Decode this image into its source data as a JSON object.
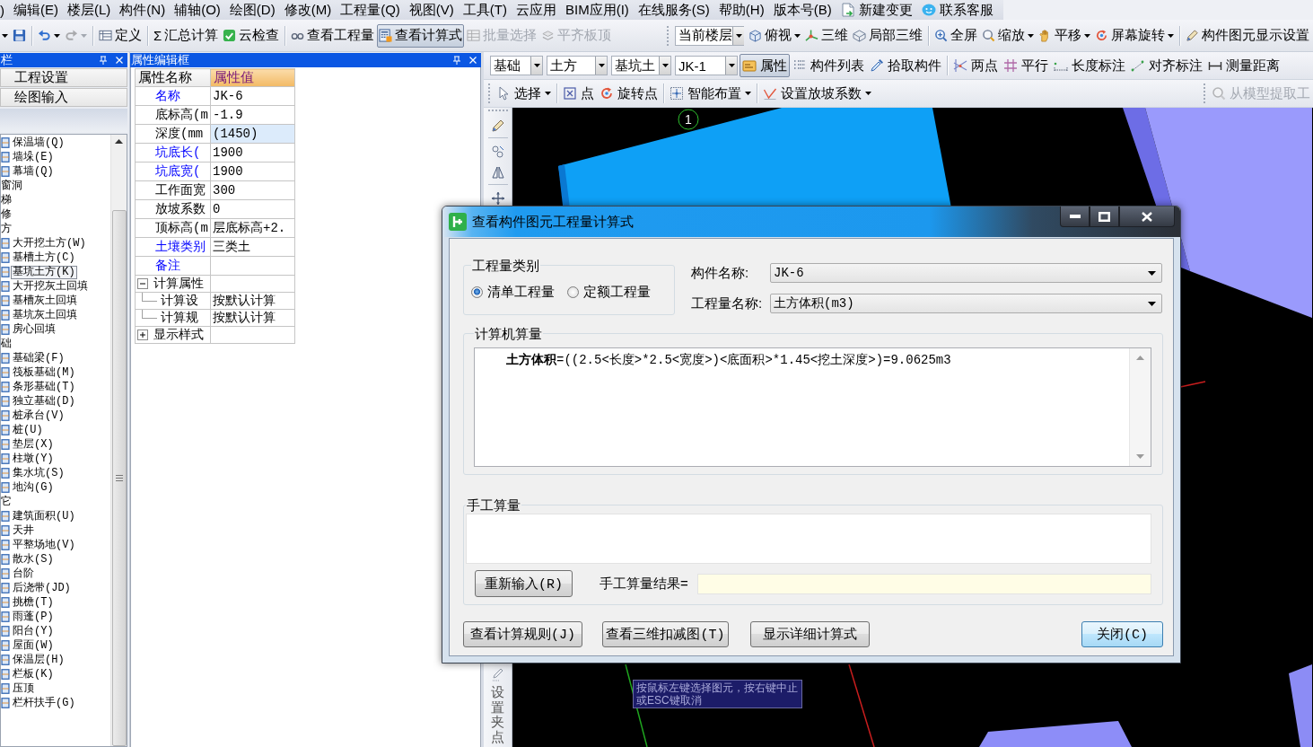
{
  "menu_bar": {
    "items": [
      {
        "kind": "plain",
        "label": ")"
      },
      {
        "kind": "plain",
        "label": "编辑(E)"
      },
      {
        "kind": "plain",
        "label": "楼层(L)"
      },
      {
        "kind": "plain",
        "label": "构件(N)"
      },
      {
        "kind": "plain",
        "label": "辅轴(O)"
      },
      {
        "kind": "plain",
        "label": "绘图(D)"
      },
      {
        "kind": "plain",
        "label": "修改(M)"
      },
      {
        "kind": "plain",
        "label": "工程量(Q)"
      },
      {
        "kind": "plain",
        "label": "视图(V)"
      },
      {
        "kind": "plain",
        "label": "工具(T)"
      },
      {
        "kind": "plain",
        "label": "云应用"
      },
      {
        "kind": "plain",
        "label": "BIM应用(I)"
      },
      {
        "kind": "plain",
        "label": "在线服务(S)"
      },
      {
        "kind": "plain",
        "label": "帮助(H)"
      },
      {
        "kind": "plain",
        "label": "版本号(B)"
      },
      {
        "kind": "document",
        "label": "新建变更"
      },
      {
        "kind": "chat",
        "label": "联系客服"
      }
    ]
  },
  "file_toolbar": {
    "items": [
      {
        "kind": "caret"
      },
      {
        "kind": "button",
        "dropdown": false,
        "pressed": false,
        "disabled": false
      },
      {
        "kind": "separator"
      },
      {
        "kind": "button",
        "dropdown": true,
        "pressed": false,
        "disabled": false
      },
      {
        "kind": "button",
        "dropdown": true,
        "pressed": false,
        "disabled": true
      },
      {
        "kind": "separator"
      },
      {
        "kind": "button",
        "label": "定义",
        "dropdown": false,
        "pressed": false,
        "disabled": false
      },
      {
        "kind": "separator"
      },
      {
        "kind": "button",
        "symbol": "Σ",
        "label": "汇总计算",
        "dropdown": false,
        "pressed": false,
        "disabled": false
      },
      {
        "kind": "button",
        "label": "云检查",
        "dropdown": false,
        "pressed": false,
        "disabled": false
      },
      {
        "kind": "separator"
      },
      {
        "kind": "button",
        "label": "查看工程量",
        "dropdown": false,
        "pressed": false,
        "disabled": false
      },
      {
        "kind": "button",
        "label": "查看计算式",
        "dropdown": false,
        "pressed": true,
        "disabled": false
      },
      {
        "kind": "button",
        "label": "批量选择",
        "dropdown": false,
        "pressed": false,
        "disabled": true
      },
      {
        "kind": "button",
        "label": "平齐板顶",
        "dropdown": false,
        "pressed": false,
        "disabled": true
      }
    ]
  },
  "view_toolbar": {
    "items": [
      {
        "kind": "combo",
        "value": "当前楼层"
      },
      {
        "kind": "button",
        "label": "俯视",
        "dropdown": true,
        "pressed": false,
        "disabled": false
      },
      {
        "kind": "button",
        "label": "三维",
        "dropdown": false,
        "pressed": false,
        "disabled": false
      },
      {
        "kind": "button",
        "label": "局部三维",
        "dropdown": false,
        "pressed": false,
        "disabled": false
      },
      {
        "kind": "separator"
      },
      {
        "kind": "button",
        "label": "全屏",
        "dropdown": false,
        "pressed": false,
        "disabled": false
      },
      {
        "kind": "button",
        "label": "缩放",
        "dropdown": true,
        "pressed": false,
        "disabled": false
      },
      {
        "kind": "button",
        "label": "平移",
        "dropdown": true,
        "pressed": false,
        "disabled": false
      },
      {
        "kind": "button",
        "label": "屏幕旋转",
        "dropdown": true,
        "pressed": false,
        "disabled": false
      },
      {
        "kind": "separator"
      },
      {
        "kind": "button",
        "label": "构件图元显示设置",
        "dropdown": false,
        "pressed": false,
        "disabled": false
      }
    ]
  },
  "component_toolbar": {
    "items": [
      {
        "kind": "combo",
        "value": "基础"
      },
      {
        "kind": "combo",
        "value": "土方"
      },
      {
        "kind": "combo",
        "value": "基坑土"
      },
      {
        "kind": "combo",
        "value": "JK-1"
      },
      {
        "kind": "button",
        "label": "属性",
        "dropdown": false,
        "pressed": true,
        "disabled": false
      },
      {
        "kind": "button",
        "label": "构件列表",
        "dropdown": false,
        "pressed": false,
        "disabled": false
      },
      {
        "kind": "button",
        "label": "拾取构件",
        "dropdown": false,
        "pressed": false,
        "disabled": false
      },
      {
        "kind": "separator"
      },
      {
        "kind": "button",
        "label": "两点",
        "dropdown": false,
        "pressed": false,
        "disabled": false
      },
      {
        "kind": "button",
        "label": "平行",
        "dropdown": false,
        "pressed": false,
        "disabled": false
      },
      {
        "kind": "button",
        "label": "长度标注",
        "dropdown": false,
        "pressed": false,
        "disabled": false
      },
      {
        "kind": "button",
        "label": "对齐标注",
        "dropdown": false,
        "pressed": false,
        "disabled": false
      },
      {
        "kind": "button",
        "label": "测量距离",
        "dropdown": false,
        "pressed": false,
        "disabled": false
      }
    ]
  },
  "draw_toolbar": {
    "items": [
      {
        "kind": "button",
        "label": "选择",
        "dropdown": true,
        "pressed": false,
        "disabled": false
      },
      {
        "kind": "separator"
      },
      {
        "kind": "button",
        "label": "点",
        "dropdown": false,
        "pressed": false,
        "disabled": false
      },
      {
        "kind": "button",
        "label": "旋转点",
        "dropdown": false,
        "pressed": false,
        "disabled": false
      },
      {
        "kind": "separator"
      },
      {
        "kind": "button",
        "label": "智能布置",
        "dropdown": true,
        "pressed": false,
        "disabled": false
      },
      {
        "kind": "separator"
      },
      {
        "kind": "button",
        "label": "设置放坡系数",
        "dropdown": true,
        "pressed": false,
        "disabled": false
      }
    ]
  },
  "extract_toolbar": {
    "items": [
      {
        "kind": "button",
        "label": "从模型提取工",
        "dropdown": false,
        "pressed": false,
        "disabled": true
      }
    ]
  },
  "left_panel": {
    "title": "栏",
    "nav_buttons": [
      "工程设置",
      "绘图输入"
    ],
    "tree": [
      {
        "children": [
          {
            "label": "保温墙(Q)",
            "selected": false
          },
          {
            "label": "墙垛(E)",
            "selected": false
          },
          {
            "label": "幕墙(Q)",
            "selected": false
          }
        ]
      },
      {
        "label": "窗洞"
      },
      {
        "label": "梯"
      },
      {
        "label": "修"
      },
      {
        "label": "方",
        "children": [
          {
            "label": "大开挖土方(W)",
            "selected": false
          },
          {
            "label": "基槽土方(C)",
            "selected": false
          },
          {
            "label": "基坑土方(K)",
            "selected": true
          },
          {
            "label": "大开挖灰土回填",
            "selected": false
          },
          {
            "label": "基槽灰土回填",
            "selected": false
          },
          {
            "label": "基坑灰土回填",
            "selected": false
          },
          {
            "label": "房心回填",
            "selected": false
          }
        ]
      },
      {
        "label": "础",
        "children": [
          {
            "label": "基础梁(F)",
            "selected": false
          },
          {
            "label": "筏板基础(M)",
            "selected": false
          },
          {
            "label": "条形基础(T)",
            "selected": false
          },
          {
            "label": "独立基础(D)",
            "selected": false
          },
          {
            "label": "桩承台(V)",
            "selected": false
          },
          {
            "label": "桩(U)",
            "selected": false
          },
          {
            "label": "垫层(X)",
            "selected": false
          },
          {
            "label": "柱墩(Y)",
            "selected": false
          },
          {
            "label": "集水坑(S)",
            "selected": false
          },
          {
            "label": "地沟(G)",
            "selected": false
          }
        ]
      },
      {
        "label": "它",
        "children": [
          {
            "label": "建筑面积(U)",
            "selected": false
          },
          {
            "label": "天井",
            "selected": false
          },
          {
            "label": "平整场地(V)",
            "selected": false
          },
          {
            "label": "散水(S)",
            "selected": false
          },
          {
            "label": "台阶",
            "selected": false
          },
          {
            "label": "后浇带(JD)",
            "selected": false
          },
          {
            "label": "挑檐(T)",
            "selected": false
          },
          {
            "label": "雨蓬(P)",
            "selected": false
          },
          {
            "label": "阳台(Y)",
            "selected": false
          },
          {
            "label": "屋面(W)",
            "selected": false
          },
          {
            "label": "保温层(H)",
            "selected": false
          },
          {
            "label": "栏板(K)",
            "selected": false
          },
          {
            "label": "压顶",
            "selected": false
          },
          {
            "label": "栏杆扶手(G)",
            "selected": false
          }
        ]
      }
    ]
  },
  "property_panel": {
    "title": "属性编辑框",
    "columns": [
      "属性名称",
      "属性值"
    ],
    "rows": [
      {
        "kind": "attr",
        "name": "名称",
        "value": "JK-6",
        "color": "#0000ff",
        "selected": false
      },
      {
        "kind": "attr",
        "name": "底标高(m",
        "value": "-1.9",
        "color": "#000000",
        "selected": false
      },
      {
        "kind": "attr",
        "name": "深度(mm",
        "value": "(1450)",
        "color": "#000000",
        "selected": true
      },
      {
        "kind": "attr",
        "name": "坑底长(",
        "value": "1900",
        "color": "#0000ff",
        "selected": false
      },
      {
        "kind": "attr",
        "name": "坑底宽(",
        "value": "1900",
        "color": "#0000ff",
        "selected": false
      },
      {
        "kind": "attr",
        "name": "工作面宽",
        "value": "300",
        "color": "#000000",
        "selected": false
      },
      {
        "kind": "attr",
        "name": "放坡系数",
        "value": "0",
        "color": "#000000",
        "selected": false
      },
      {
        "kind": "attr",
        "name": "顶标高(m",
        "value": "层底标高+2.",
        "color": "#000000",
        "selected": false
      },
      {
        "kind": "attr",
        "name": "土壤类别",
        "value": "三类土",
        "color": "#0000ff",
        "selected": false
      },
      {
        "kind": "attr",
        "name": "备注",
        "color": "#0000ff",
        "selected": false
      },
      {
        "kind": "group",
        "name": "计算属性",
        "expanded": true,
        "children": [
          {
            "name": "计算设",
            "value": "按默认计算"
          },
          {
            "name": "计算规",
            "value": "按默认计算"
          }
        ]
      },
      {
        "kind": "group",
        "name": "显示样式",
        "expanded": false
      }
    ]
  },
  "vertical_toolbar": {
    "label": "设置夹点"
  },
  "canvas": {
    "axis_label": "1",
    "hint": "按鼠标左键选择图元，按右键中止或ESC键取消"
  },
  "dialog": {
    "title": "查看构件图元工程量计算式",
    "quantity_type": {
      "label": "工程量类别",
      "options": [
        {
          "label": "清单工程量",
          "selected": true
        },
        {
          "label": "定额工程量",
          "selected": false
        }
      ]
    },
    "fields": [
      {
        "label": "构件名称:",
        "value": "JK-6"
      },
      {
        "label": "工程量名称:",
        "value": "土方体积(m3)"
      }
    ],
    "computer_calc": {
      "label": "计算机算量",
      "term": "土方体积",
      "expression": "=((2.5<长度>*2.5<宽度>)<底面积>*1.45<挖土深度>)=9.0625m3"
    },
    "manual_calc": {
      "label": "手工算量",
      "reenter_button": "重新输入(R)",
      "result_label": "手工算量结果="
    },
    "buttons": [
      {
        "label": "查看计算规则(J)",
        "default": false
      },
      {
        "label": "查看三维扣减图(T)",
        "default": false
      },
      {
        "label": "显示详细计算式",
        "default": false
      },
      {
        "label": "关闭(C)",
        "default": true
      }
    ]
  }
}
